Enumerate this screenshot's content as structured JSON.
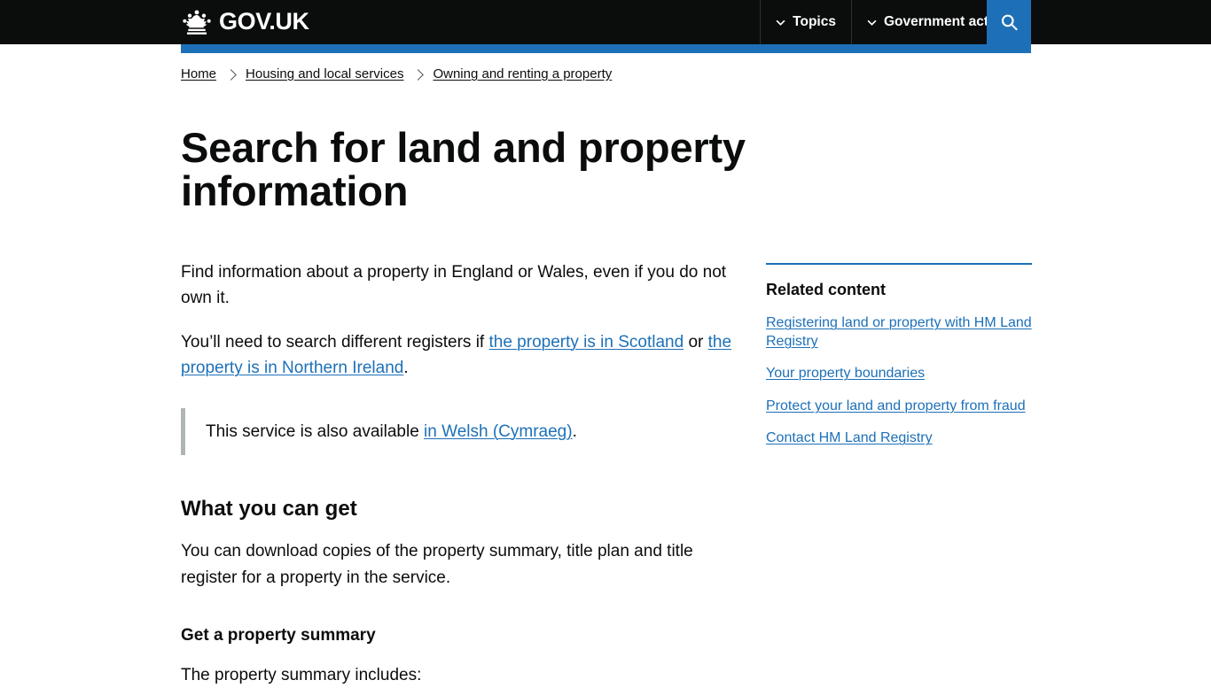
{
  "header": {
    "logo_text": "GOV.UK",
    "crown_icon": "crown-icon",
    "nav": [
      {
        "label": "Topics",
        "icon": "chevron-down-icon"
      },
      {
        "label": "Government activity",
        "icon": "chevron-down-icon"
      }
    ],
    "search_icon": "search-icon",
    "accent_color": "#1d70b8",
    "background_color": "#0b0c0c"
  },
  "breadcrumb": {
    "items": [
      {
        "label": "Home"
      },
      {
        "label": "Housing and local services"
      },
      {
        "label": "Owning and renting a property"
      }
    ],
    "separator_icon": "chevron-right-icon"
  },
  "main": {
    "title": "Search for land and property information",
    "intro": {
      "p1": "Find information about a property in England or Wales, even if you do not own it.",
      "p2_before": "You’ll need to search different registers if ",
      "p2_link1": "the property is in Scotland",
      "p2_middle": " or ",
      "p2_link2": "the property is in Northern Ireland",
      "p2_after": "."
    },
    "inset": {
      "text_before": "This service is also available ",
      "link": "in Welsh (Cymraeg)",
      "text_after": "."
    },
    "section1": {
      "heading": "What you can get",
      "paragraph": "You can download copies of the property summary, title plan and title register for a property in the service.",
      "subheading": "Get a property summary",
      "lead_in": "The property summary includes:"
    }
  },
  "sidebar": {
    "related": {
      "title": "Related content",
      "links": [
        "Registering land or property with HM Land Registry",
        "Your property boundaries",
        "Protect your land and property from fraud",
        "Contact HM Land Registry"
      ]
    }
  }
}
